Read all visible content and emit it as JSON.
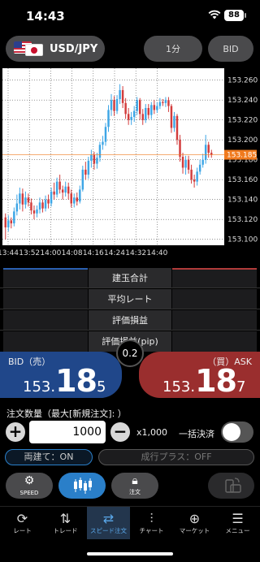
{
  "status_bar": {
    "time": "14:43",
    "battery": "88"
  },
  "header": {
    "currency_pair": "USD/JPY",
    "timeframe": "1分",
    "price_type": "BID"
  },
  "chart_data": {
    "type": "candlestick",
    "x_ticks": [
      "13:44",
      "13:52",
      "14:00",
      "14:08",
      "14:16",
      "14:24",
      "14:32",
      "14:40"
    ],
    "y_ticks": [
      "153.260",
      "153.240",
      "153.220",
      "153.200",
      "153.180",
      "153.160",
      "153.140",
      "153.120",
      "153.100"
    ],
    "ylim": [
      153.094,
      153.272
    ],
    "current_price_label": "153.185",
    "colors": {
      "up": "#3ea6e6",
      "down": "#d23c3c",
      "current": "#f07a1e",
      "grid": "#555555",
      "background": "#ffffff"
    },
    "candles": [
      [
        153.122,
        153.112,
        153.126,
        153.1
      ],
      [
        153.112,
        153.119,
        153.124,
        153.108
      ],
      [
        153.119,
        153.116,
        153.122,
        153.111
      ],
      [
        153.116,
        153.128,
        153.132,
        153.113
      ],
      [
        153.128,
        153.136,
        153.145,
        153.124
      ],
      [
        153.136,
        153.146,
        153.152,
        153.13
      ],
      [
        153.146,
        153.135,
        153.151,
        153.128
      ],
      [
        153.135,
        153.142,
        153.148,
        153.131
      ],
      [
        153.142,
        153.137,
        153.146,
        153.133
      ],
      [
        153.137,
        153.129,
        153.141,
        153.125
      ],
      [
        153.129,
        153.126,
        153.134,
        153.12
      ],
      [
        153.126,
        153.13,
        153.134,
        153.122
      ],
      [
        153.13,
        153.137,
        153.142,
        153.126
      ],
      [
        153.137,
        153.131,
        153.14,
        153.127
      ],
      [
        153.131,
        153.14,
        153.144,
        153.128
      ],
      [
        153.14,
        153.136,
        153.145,
        153.131
      ],
      [
        153.136,
        153.148,
        153.152,
        153.133
      ],
      [
        153.148,
        153.145,
        153.157,
        153.14
      ],
      [
        153.145,
        153.158,
        153.162,
        153.142
      ],
      [
        153.158,
        153.15,
        153.165,
        153.146
      ],
      [
        153.15,
        153.147,
        153.154,
        153.14
      ],
      [
        153.147,
        153.153,
        153.158,
        153.143
      ],
      [
        153.153,
        153.146,
        153.157,
        153.14
      ],
      [
        153.146,
        153.136,
        153.15,
        153.132
      ],
      [
        153.136,
        153.142,
        153.146,
        153.132
      ],
      [
        153.142,
        153.138,
        153.147,
        153.134
      ],
      [
        153.138,
        153.15,
        153.154,
        153.136
      ],
      [
        153.15,
        153.17,
        153.174,
        153.148
      ],
      [
        153.17,
        153.165,
        153.178,
        153.16
      ],
      [
        153.165,
        153.179,
        153.183,
        153.161
      ],
      [
        153.179,
        153.185,
        153.19,
        153.172
      ],
      [
        153.185,
        153.176,
        153.188,
        153.17
      ],
      [
        153.176,
        153.182,
        153.187,
        153.171
      ],
      [
        153.182,
        153.195,
        153.198,
        153.178
      ],
      [
        153.195,
        153.198,
        153.204,
        153.19
      ],
      [
        153.198,
        153.213,
        153.217,
        153.194
      ],
      [
        153.213,
        153.23,
        153.235,
        153.208
      ],
      [
        153.23,
        153.24,
        153.246,
        153.224
      ],
      [
        153.24,
        153.229,
        153.244,
        153.224
      ],
      [
        153.229,
        153.241,
        153.245,
        153.226
      ],
      [
        153.241,
        153.25,
        153.256,
        153.236
      ],
      [
        153.25,
        153.237,
        153.254,
        153.232
      ],
      [
        153.237,
        153.226,
        153.242,
        153.221
      ],
      [
        153.226,
        153.22,
        153.232,
        153.215
      ],
      [
        153.22,
        153.223,
        153.228,
        153.215
      ],
      [
        153.223,
        153.229,
        153.234,
        153.218
      ],
      [
        153.229,
        153.24,
        153.243,
        153.225
      ],
      [
        153.24,
        153.226,
        153.242,
        153.22
      ],
      [
        153.226,
        153.22,
        153.231,
        153.215
      ],
      [
        153.22,
        153.232,
        153.236,
        153.217
      ],
      [
        153.232,
        153.225,
        153.236,
        153.221
      ],
      [
        153.225,
        153.235,
        153.238,
        153.221
      ],
      [
        153.235,
        153.23,
        153.24,
        153.226
      ],
      [
        153.23,
        153.234,
        153.238,
        153.227
      ],
      [
        153.234,
        153.238,
        153.242,
        153.231
      ],
      [
        153.238,
        153.237,
        153.241,
        153.234
      ],
      [
        153.237,
        153.24,
        153.243,
        153.233
      ],
      [
        153.24,
        153.234,
        153.243,
        153.228
      ],
      [
        153.234,
        153.212,
        153.236,
        153.207
      ],
      [
        153.212,
        153.224,
        153.228,
        153.208
      ],
      [
        153.224,
        153.2,
        153.226,
        153.195
      ],
      [
        153.2,
        153.183,
        153.205,
        153.178
      ],
      [
        153.183,
        153.172,
        153.187,
        153.166
      ],
      [
        153.172,
        153.18,
        153.184,
        153.165
      ],
      [
        153.18,
        153.17,
        153.184,
        153.166
      ],
      [
        153.17,
        153.16,
        153.175,
        153.156
      ],
      [
        153.16,
        153.158,
        153.165,
        153.152
      ],
      [
        153.158,
        153.168,
        153.172,
        153.154
      ],
      [
        153.168,
        153.175,
        153.18,
        153.165
      ],
      [
        153.175,
        153.18,
        153.186,
        153.172
      ],
      [
        153.18,
        153.195,
        153.205,
        153.176
      ],
      [
        153.195,
        153.187,
        153.198,
        153.182
      ],
      [
        153.187,
        153.185,
        153.19,
        153.182
      ]
    ]
  },
  "stats": {
    "rows": [
      "建玉合計",
      "平均レート",
      "評価損益",
      "評価損益(pip)"
    ]
  },
  "quote": {
    "bid_label": "BID（売）",
    "ask_label": "（買）ASK",
    "bid_price": {
      "head": "153.",
      "big": "18",
      "tail": "5"
    },
    "ask_price": {
      "head": "153.",
      "big": "18",
      "tail": "7"
    },
    "spread": "0.2"
  },
  "order": {
    "qty_label": "注文数量（最大[新規注文]: ）",
    "quantity": "1000",
    "multiplier": "x1,000",
    "bulk_settle_label": "一括決済",
    "bulk_settle_on": false,
    "ryodate_label": "両建て：ON",
    "nariyuki_label": "成行プラス：OFF"
  },
  "actions": {
    "speed_label": "SPEED",
    "order_label": "注文"
  },
  "tab_bar": {
    "items": [
      {
        "label": "レート",
        "icon": "rate-icon"
      },
      {
        "label": "トレード",
        "icon": "trade-icon"
      },
      {
        "label": "スピード注文",
        "icon": "speed-order-icon"
      },
      {
        "label": "チャート",
        "icon": "chart-icon"
      },
      {
        "label": "マーケット",
        "icon": "globe-icon"
      },
      {
        "label": "メニュー",
        "icon": "menu-icon"
      }
    ],
    "active_index": 2
  }
}
